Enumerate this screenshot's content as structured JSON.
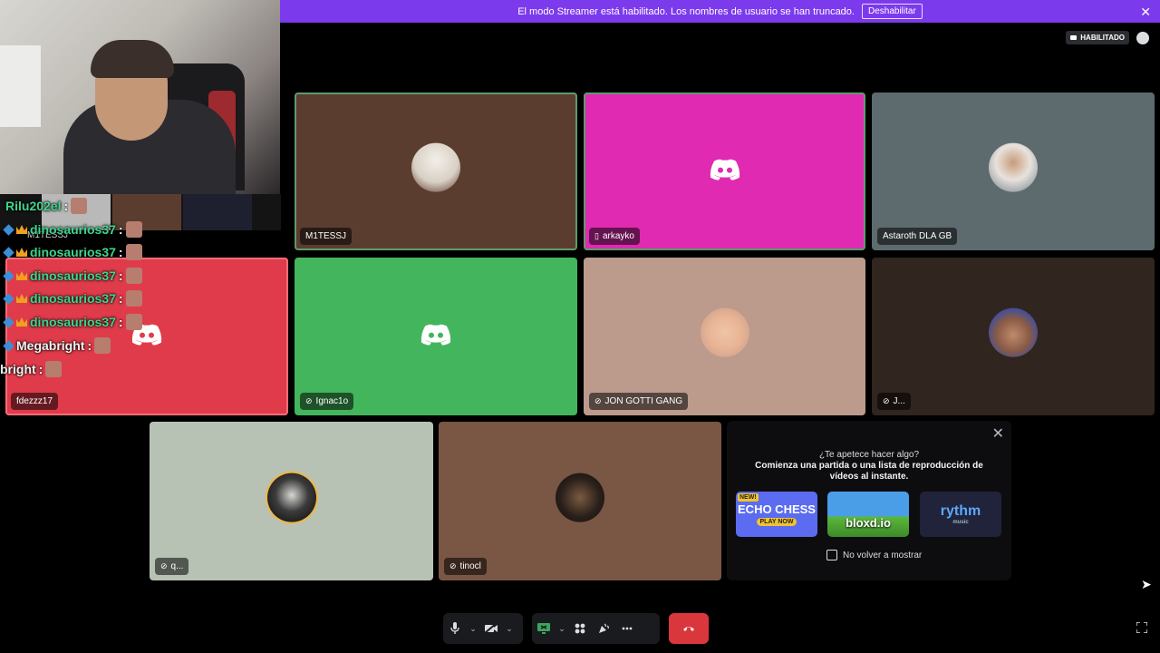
{
  "banner": {
    "text": "El modo Streamer está habilitado. Los nombres de usuario se han truncado.",
    "button": "Deshabilitar"
  },
  "topright": {
    "live_label": "HABILITADO"
  },
  "tiles": [
    {
      "name": "M1TESSJ",
      "color": "#5b3d30",
      "icon": "none"
    },
    {
      "name": "arkayko",
      "color": "#e02ab1",
      "icon": "phone-icon"
    },
    {
      "name": "Astaroth DLA GB",
      "color": "#5d6b6e",
      "icon": "none"
    },
    {
      "name": "fdezzz17",
      "color": "#e03b4a",
      "icon": "none"
    },
    {
      "name": "Ignac1o",
      "color": "#43b55c",
      "icon": "deafened-icon"
    },
    {
      "name": "JON GOTTI GANG",
      "color": "#bc9a8c",
      "icon": "deafened-icon"
    },
    {
      "name": "J...",
      "color": "#30251f",
      "icon": "deafened-icon"
    },
    {
      "name": "q...",
      "color": "#b7c2b4",
      "icon": "deafened-icon"
    },
    {
      "name": "tinocl",
      "color": "#7a5644",
      "icon": "deafened-icon"
    }
  ],
  "chat": {
    "lines": [
      {
        "user": "Rilu202el",
        "sep": ":",
        "color": "green"
      },
      {
        "user": "dinosaurios37",
        "sep": ":",
        "color": "green"
      },
      {
        "user": "dinosaurios37",
        "sep": ":",
        "color": "green"
      },
      {
        "user": "dinosaurios37",
        "sep": ":",
        "color": "green"
      },
      {
        "user": "dinosaurios37",
        "sep": ":",
        "color": "green"
      },
      {
        "user": "dinosaurios37",
        "sep": ":",
        "color": "green"
      },
      {
        "user": "Megabright",
        "sep": ":",
        "color": "white"
      },
      {
        "user": "bright",
        "sep": ":",
        "color": "white"
      }
    ],
    "mini_label": "M1TESSJ"
  },
  "activity": {
    "title": "¿Te apetece hacer algo?",
    "subtitle": "Comienza una partida o una lista de reproducción de vídeos al instante.",
    "cards": [
      {
        "label": "ECHO CHESS",
        "sub": "PLAY NOW",
        "badge": "NEW!",
        "color": "#5b6cf0"
      },
      {
        "label": "bloxd.io",
        "color": "#4a9ee8"
      },
      {
        "label": "rythm",
        "sub": "music",
        "color": "#20233a"
      }
    ],
    "checkbox_label": "No volver a mostrar"
  }
}
